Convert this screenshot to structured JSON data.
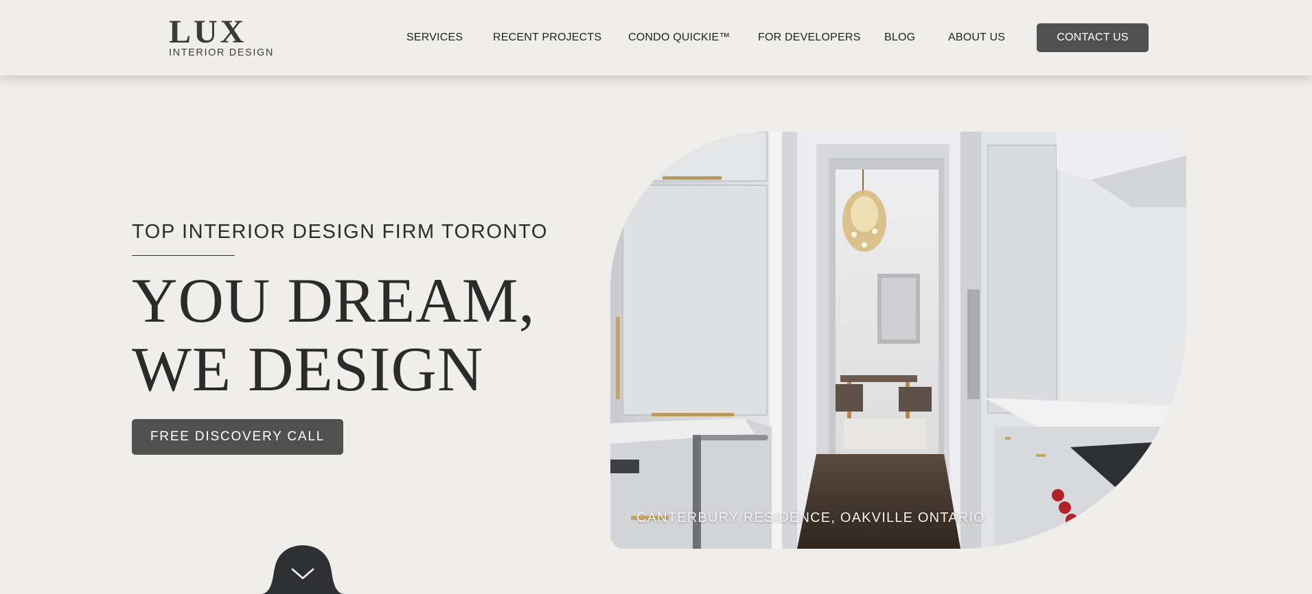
{
  "header": {
    "logo_mark": "LUX",
    "logo_sub": "INTERIOR  DESIGN",
    "nav": [
      {
        "label": "SERVICES"
      },
      {
        "label": "RECENT PROJECTS"
      },
      {
        "label": "CONDO QUICKIE™"
      },
      {
        "label": "FOR DEVELOPERS"
      },
      {
        "label": "BLOG"
      },
      {
        "label": "ABOUT US"
      }
    ],
    "contact_label": "CONTACT US"
  },
  "hero": {
    "eyebrow": "TOP INTERIOR DESIGN FIRM TORONTO",
    "headline_line1": "YOU DREAM,",
    "headline_line2": "WE DESIGN",
    "cta_label": "FREE DISCOVERY CALL",
    "image_caption": "CANTERBURY RESIDENCE, OAKVILLE ONTARIO",
    "scroll_icon": "chevron-down-icon"
  },
  "colors": {
    "background": "#f0eeea",
    "button": "#505050",
    "text": "#2b2b2b",
    "scroll_tab": "#2e3033"
  }
}
